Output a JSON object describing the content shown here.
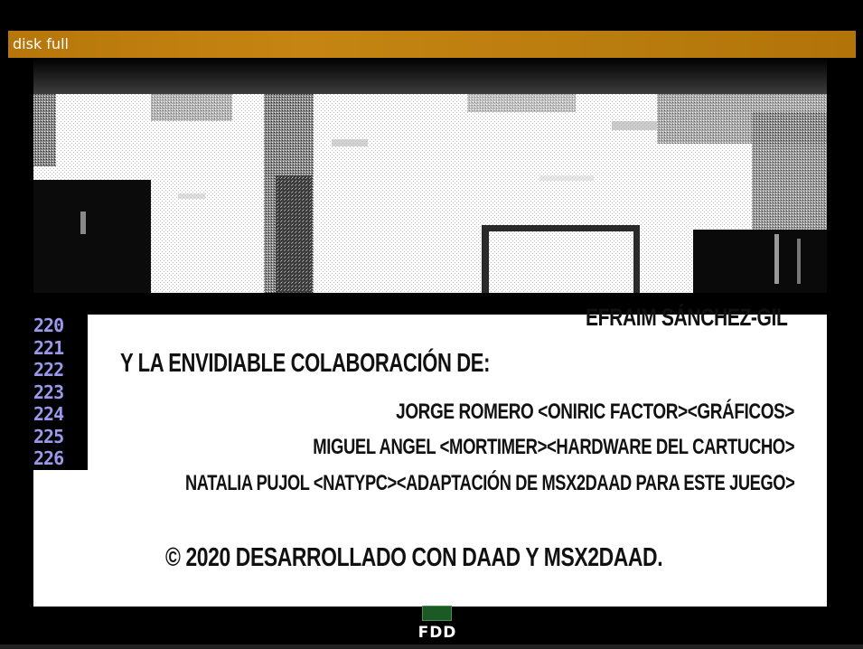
{
  "notification": {
    "text": "disk full"
  },
  "photo": {
    "icon": "room-photo"
  },
  "line_numbers": [
    "220",
    "221",
    "222",
    "223",
    "224",
    "225",
    "226"
  ],
  "credits": {
    "author": "EFRAIM SÁNCHEZ-GIL",
    "collab_heading": "Y LA ENVIDIABLE COLABORACIÓN DE:",
    "credit_1": "JORGE ROMERO <ONIRIC FACTOR><GRÁFICOS>",
    "credit_2": "MIGUEL ANGEL <MORTIMER><HARDWARE DEL CARTUCHO>",
    "credit_3": "NATALIA PUJOL <NATYPC><ADAPTACIÓN DE MSX2DAAD PARA ESTE JUEGO>",
    "footer": "© 2020 DESARROLLADO CON DAAD Y MSX2DAAD."
  },
  "status": {
    "fdd_label": "FDD",
    "fdd_led_color": "#1c5a25"
  },
  "colors": {
    "notify_bar": "#c68512",
    "line_number_text": "#9999ee",
    "panel_bg": "#ffffff"
  }
}
